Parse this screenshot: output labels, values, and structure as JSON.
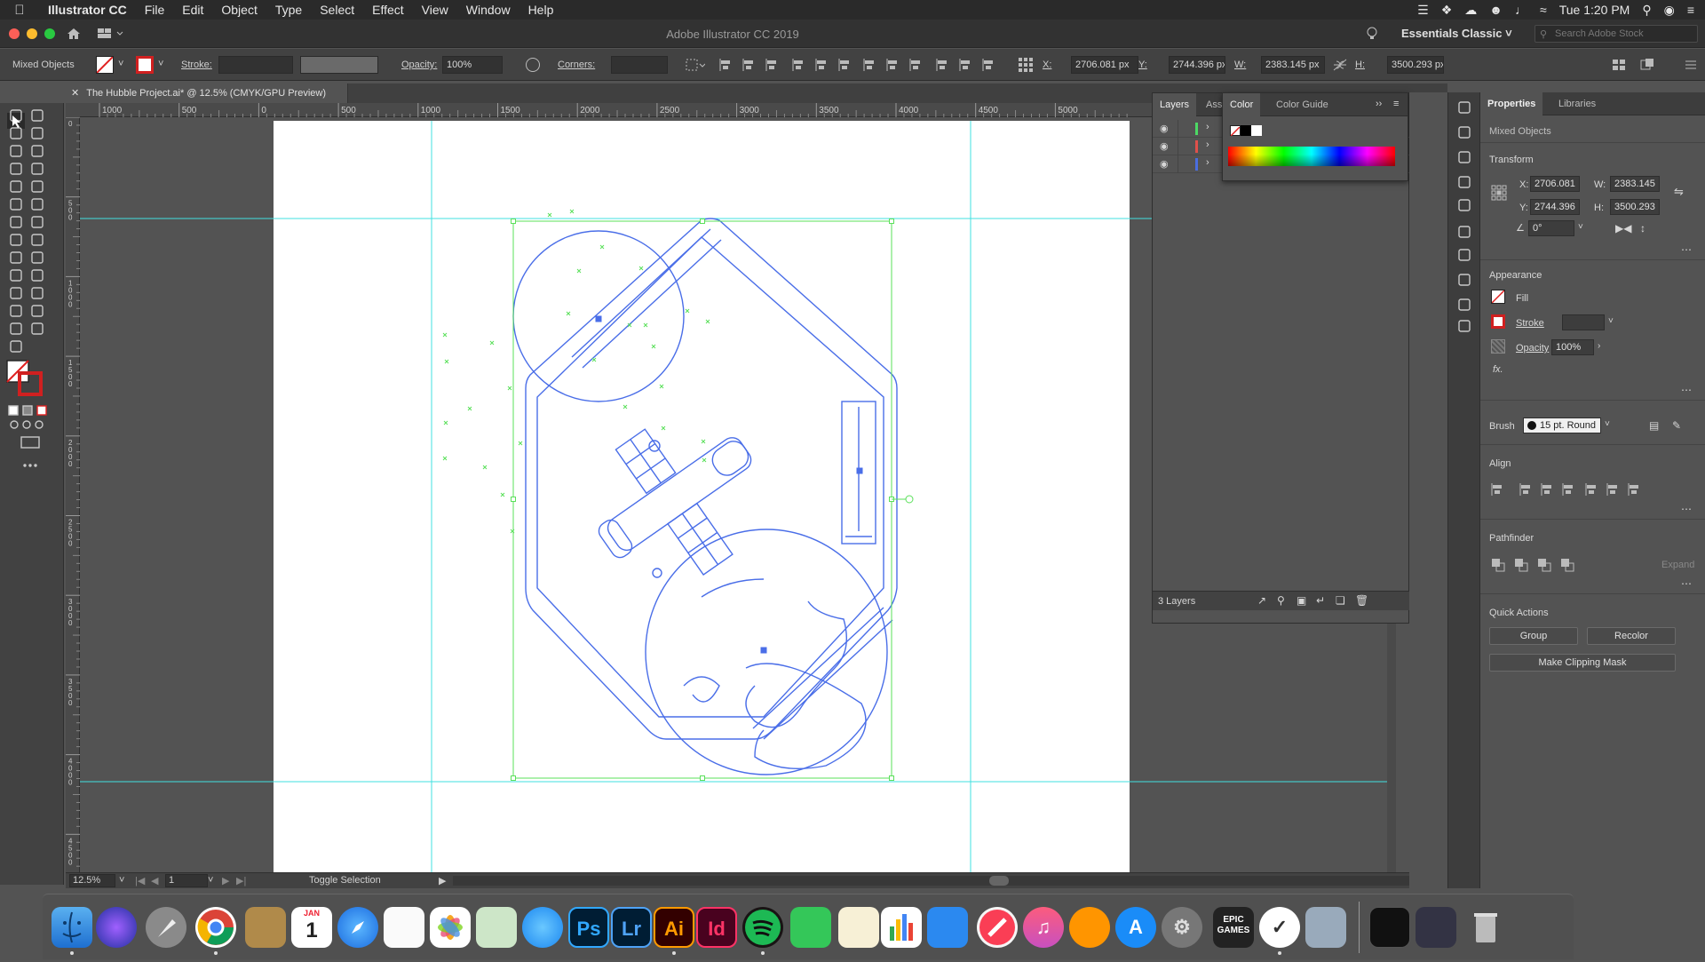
{
  "menubar": {
    "app_name": "Illustrator CC",
    "items": [
      "File",
      "Edit",
      "Object",
      "Type",
      "Select",
      "Effect",
      "View",
      "Window",
      "Help"
    ],
    "clock": "Tue 1:20 PM"
  },
  "titlebar": {
    "title": "Adobe Illustrator CC 2019",
    "workspace": "Essentials Classic",
    "search_placeholder": "Search Adobe Stock"
  },
  "control_bar": {
    "selection": "Mixed Objects",
    "stroke_label": "Stroke:",
    "opacity_label": "Opacity:",
    "opacity_value": "100%",
    "corners_label": "Corners:",
    "x_label": "X:",
    "x_value": "2706.081 px",
    "y_label": "Y:",
    "y_value": "2744.396 px",
    "w_label": "W:",
    "w_value": "2383.145 px",
    "h_label": "H:",
    "h_value": "3500.293 px"
  },
  "document": {
    "tab_title": "The Hubble Project.ai* @ 12.5% (CMYK/GPU Preview)",
    "ruler_labels": [
      "1000",
      "500",
      "0",
      "500",
      "1000",
      "1500",
      "2000",
      "2500",
      "3000",
      "3500",
      "4000",
      "4500",
      "5000"
    ],
    "vruler_labels": [
      "0",
      "5\n0\n0",
      "1\n0\n0\n0",
      "1\n5\n0\n0",
      "2\n0\n0\n0",
      "2\n5\n0\n0",
      "3\n0\n0\n0",
      "3\n5\n0\n0",
      "4\n0\n0\n0",
      "4\n5\n0\n0",
      "5\n0\n0\n0"
    ]
  },
  "status_bar": {
    "zoom": "12.5%",
    "artboard_num": "1",
    "mode": "Toggle Selection"
  },
  "layers_panel": {
    "tabs": [
      "Layers",
      "Ass"
    ],
    "count": "3 Layers",
    "layer_colors": [
      "#4cd964",
      "#e0504a",
      "#4a6ee0"
    ]
  },
  "color_panel": {
    "tabs": [
      "Color",
      "Color Guide"
    ]
  },
  "properties_panel": {
    "tabs": [
      "Properties",
      "Libraries"
    ],
    "selection": "Mixed Objects",
    "transform_title": "Transform",
    "x_label": "X:",
    "x_value": "2706.081",
    "y_label": "Y:",
    "y_value": "2744.396",
    "w_label": "W:",
    "w_value": "2383.145",
    "h_label": "H:",
    "h_value": "3500.293",
    "rotation": "0°",
    "appearance_title": "Appearance",
    "fill_label": "Fill",
    "stroke_label": "Stroke",
    "opacity_label": "Opacity",
    "opacity_value": "100%",
    "fx_label": "fx.",
    "brush_label": "Brush",
    "brush_value": "15 pt. Round",
    "align_title": "Align",
    "pathfinder_title": "Pathfinder",
    "expand_label": "Expand",
    "quick_actions_title": "Quick Actions",
    "group_btn": "Group",
    "recolor_btn": "Recolor",
    "clip_btn": "Make Clipping Mask"
  },
  "dock": {
    "labeled_apps": [
      {
        "name": "photoshop",
        "text": "Ps",
        "bg": "#001d34",
        "fg": "#31a8ff"
      },
      {
        "name": "lightroom",
        "text": "Lr",
        "bg": "#001d34",
        "fg": "#4fa3f7"
      },
      {
        "name": "illustrator",
        "text": "Ai",
        "bg": "#330000",
        "fg": "#ff9a00"
      },
      {
        "name": "indesign",
        "text": "Id",
        "bg": "#49021f",
        "fg": "#ff3366"
      }
    ],
    "calendar_month": "JAN",
    "calendar_day": "1",
    "epic_label": "EPIC\nGAMES"
  },
  "colors": {
    "accent_cyan": "#40e0e0",
    "art_blue": "#4a6ee8",
    "selection_green": "#5ae05a"
  }
}
